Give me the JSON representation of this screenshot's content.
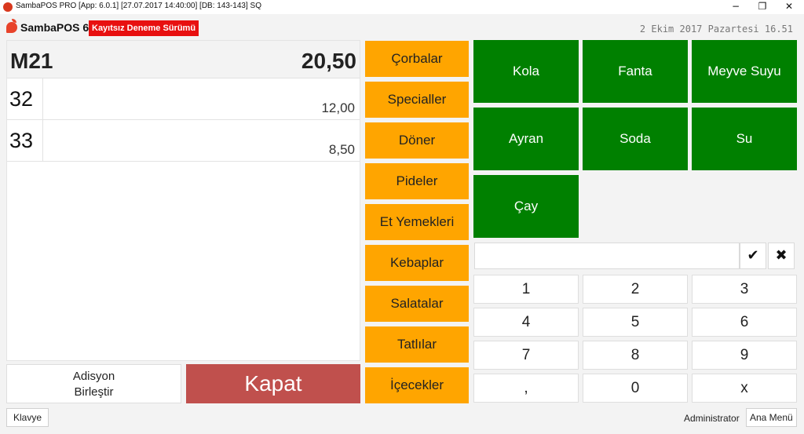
{
  "window": {
    "title": "SambaPOS PRO [App: 6.0.1] [27.07.2017 14:40:00] [DB: 143-143] SQ",
    "controls": {
      "minimize": "−",
      "restore": "❐",
      "close": "✕"
    }
  },
  "header": {
    "app_name": "SambaPOS 6",
    "trial_badge": "Kayıtsız Deneme Sürümü",
    "date": "2 Ekim 2017 Pazartesi 16.51"
  },
  "ticket": {
    "table": "M21",
    "total": "20,50",
    "rows": [
      {
        "qty": "32",
        "price": "12,00"
      },
      {
        "qty": "33",
        "price": "8,50"
      }
    ]
  },
  "actions": {
    "merge_line1": "Adisyon",
    "merge_line2": "Birleştir",
    "close": "Kapat"
  },
  "categories": [
    "Çorbalar",
    "Specialler",
    "Döner",
    "Pideler",
    "Et Yemekleri",
    "Kebaplar",
    "Salatalar",
    "Tatlılar",
    "İçecekler"
  ],
  "products": [
    "Kola",
    "Fanta",
    "Meyve Suyu",
    "Ayran",
    "Soda",
    "Su",
    "Çay"
  ],
  "numpad": {
    "input_value": "",
    "confirm_icon": "✔",
    "clear_icon": "✖",
    "keys": [
      "1",
      "2",
      "3",
      "4",
      "5",
      "6",
      "7",
      "8",
      "9",
      ",",
      "0",
      "x"
    ]
  },
  "footer": {
    "keyboard": "Klavye",
    "user": "Administrator",
    "main_menu": "Ana Menü"
  },
  "colors": {
    "category": "#ffa500",
    "product": "#008000",
    "close_button": "#c0504d",
    "trial_badge": "#e81010"
  }
}
